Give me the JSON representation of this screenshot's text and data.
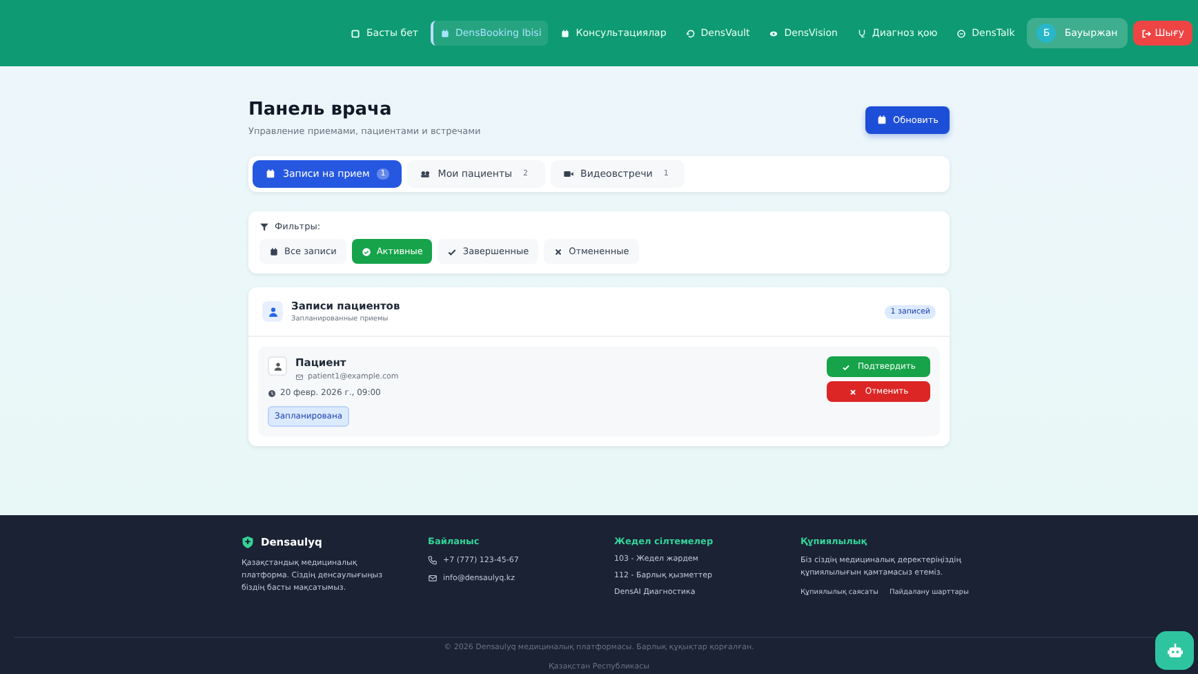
{
  "nav": {
    "items": [
      {
        "label": "Басты бет",
        "kind": "home",
        "selected": false
      },
      {
        "label": "DensBooking Ibisi",
        "kind": "calendar",
        "selected": true
      },
      {
        "label": "Консультациялар",
        "kind": "calendar",
        "selected": false
      },
      {
        "label": "DensVault",
        "kind": "vault",
        "selected": false
      },
      {
        "label": "DensVision",
        "kind": "eye",
        "selected": false
      },
      {
        "label": "Диагноз қою",
        "kind": "steth",
        "selected": false
      },
      {
        "label": "DensTalk",
        "kind": "chat",
        "selected": false
      }
    ],
    "user": {
      "initial": "Б",
      "name": "Бауыржан"
    },
    "logout": "Шығу"
  },
  "page": {
    "title": "Панель врача",
    "subtitle": "Управление приемами, пациентами и встречами",
    "refresh": "Обновить"
  },
  "tabs": [
    {
      "label": "Записи на прием",
      "kind": "calendar",
      "count": "1",
      "selected": true
    },
    {
      "label": "Мои пациенты",
      "kind": "users",
      "count": "2",
      "selected": false
    },
    {
      "label": "Видеовстречи",
      "kind": "video",
      "count": "1",
      "selected": false
    }
  ],
  "filters": {
    "title": "Фильтры:",
    "items": [
      {
        "label": "Все записи",
        "kind": "calendar",
        "selected": false
      },
      {
        "label": "Активные",
        "kind": "active",
        "selected": true
      },
      {
        "label": "Завершенные",
        "kind": "done",
        "selected": false
      },
      {
        "label": "Отмененные",
        "kind": "cancelled",
        "selected": false
      }
    ]
  },
  "records": {
    "title": "Записи пациентов",
    "subtitle": "Запланированные приемы",
    "count": "1 записей",
    "items": [
      {
        "name": "Пациент",
        "email": "patient1@example.com",
        "datetime": "20 февр. 2026 г., 09:00",
        "status": "Запланирована",
        "confirm": "Подтвердить",
        "cancel": "Отменить"
      }
    ]
  },
  "footer": {
    "brand": "Densaulyq",
    "description": "Қазақстандық медициналық платформа. Сіздің денсаулығыңыз біздің басты мақсатымыз.",
    "columns": [
      {
        "title": "Байланыс",
        "kind": "contacts",
        "items": [
          {
            "kind": "phone",
            "text": "+7 (777) 123-45-67"
          },
          {
            "kind": "mail",
            "text": "info@densaulyq.kz"
          }
        ]
      },
      {
        "title": "Жедел сілтемелер",
        "kind": "links",
        "items": [
          {
            "text": "103 - Жедел жәрдем"
          },
          {
            "text": "112 - Барлық қызметтер"
          },
          {
            "text": "DensAI Диагностика"
          }
        ]
      },
      {
        "title": "Құпиялылық",
        "kind": "privacy",
        "text": "Біз сіздің медициналық деректеріңіздің құпиялылығын қамтамасыз етеміз.",
        "items": [
          {
            "text": "Құпиялылық саясаты"
          },
          {
            "text": "Пайдалану шарттары"
          }
        ]
      }
    ],
    "copyright": "© 2026 Densaulyq медициналық платформасы. Барлық құқықтар қорғалған.",
    "country": "Қазақстан Республикасы"
  }
}
